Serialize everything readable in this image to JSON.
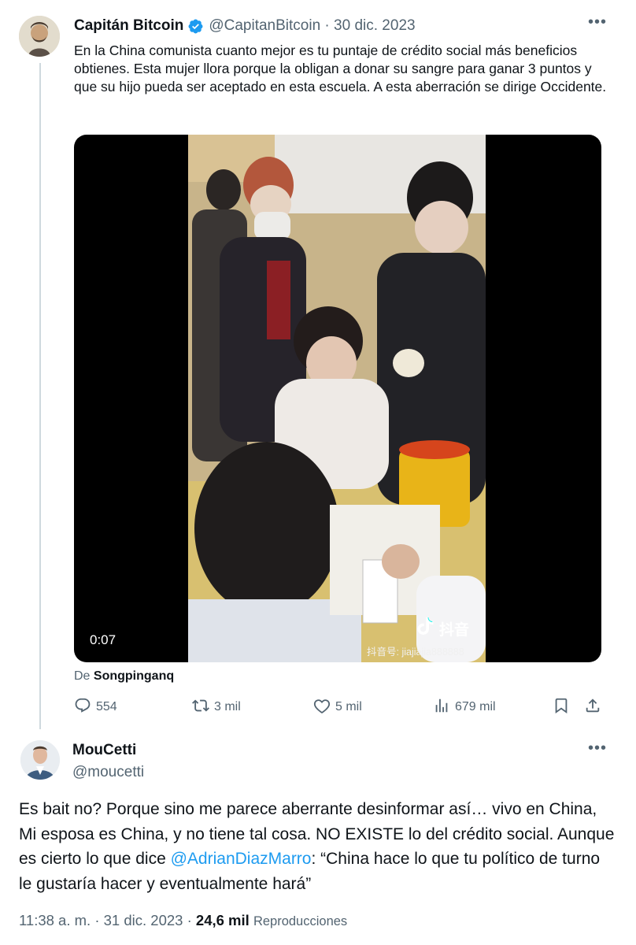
{
  "tweet": {
    "author_name": "Capitán Bitcoin",
    "author_handle": "@CapitanBitcoin",
    "date": "30 dic. 2023",
    "text": "En la China comunista cuanto mejor es tu puntaje de crédito social más beneficios obtienes. Esta mujer llora porque la obligan a donar su sangre para ganar 3 puntos y que su hijo pueda ser aceptado en esta escuela. A esta aberración se dirige Occidente.",
    "video": {
      "timecode": "0:07",
      "watermark_brand": "抖音",
      "watermark_id": "抖音号: jiajiajia888888"
    },
    "source_prefix": "De",
    "source_name": "Songpinganq",
    "stats": {
      "replies": "554",
      "retweets": "3 mil",
      "likes": "5 mil",
      "views": "679 mil"
    }
  },
  "reply": {
    "author_name": "MouCetti",
    "author_handle": "@moucetti",
    "text_before": "Es bait no? Porque sino me parece aberrante desinformar así… vivo en China, Mi esposa es China, y no tiene tal cosa. NO EXISTE lo del crédito social. Aunque es cierto lo que dice ",
    "mention": "@AdrianDiazMarro",
    "text_after": ": “China hace lo que tu político de turno  le gustaría hacer y eventualmente hará”",
    "time": "11:38 a. m.",
    "date": "31 dic. 2023",
    "views_count": "24,6 mil",
    "views_label": "Reproducciones"
  },
  "colors": {
    "verified": "#1d9bf0",
    "link": "#1d9bf0",
    "secondary_text": "#536471"
  },
  "icons": [
    "more-icon",
    "verified-badge-icon",
    "reply-icon",
    "retweet-icon",
    "like-icon",
    "views-icon",
    "bookmark-icon",
    "share-icon",
    "tiktok-icon"
  ]
}
